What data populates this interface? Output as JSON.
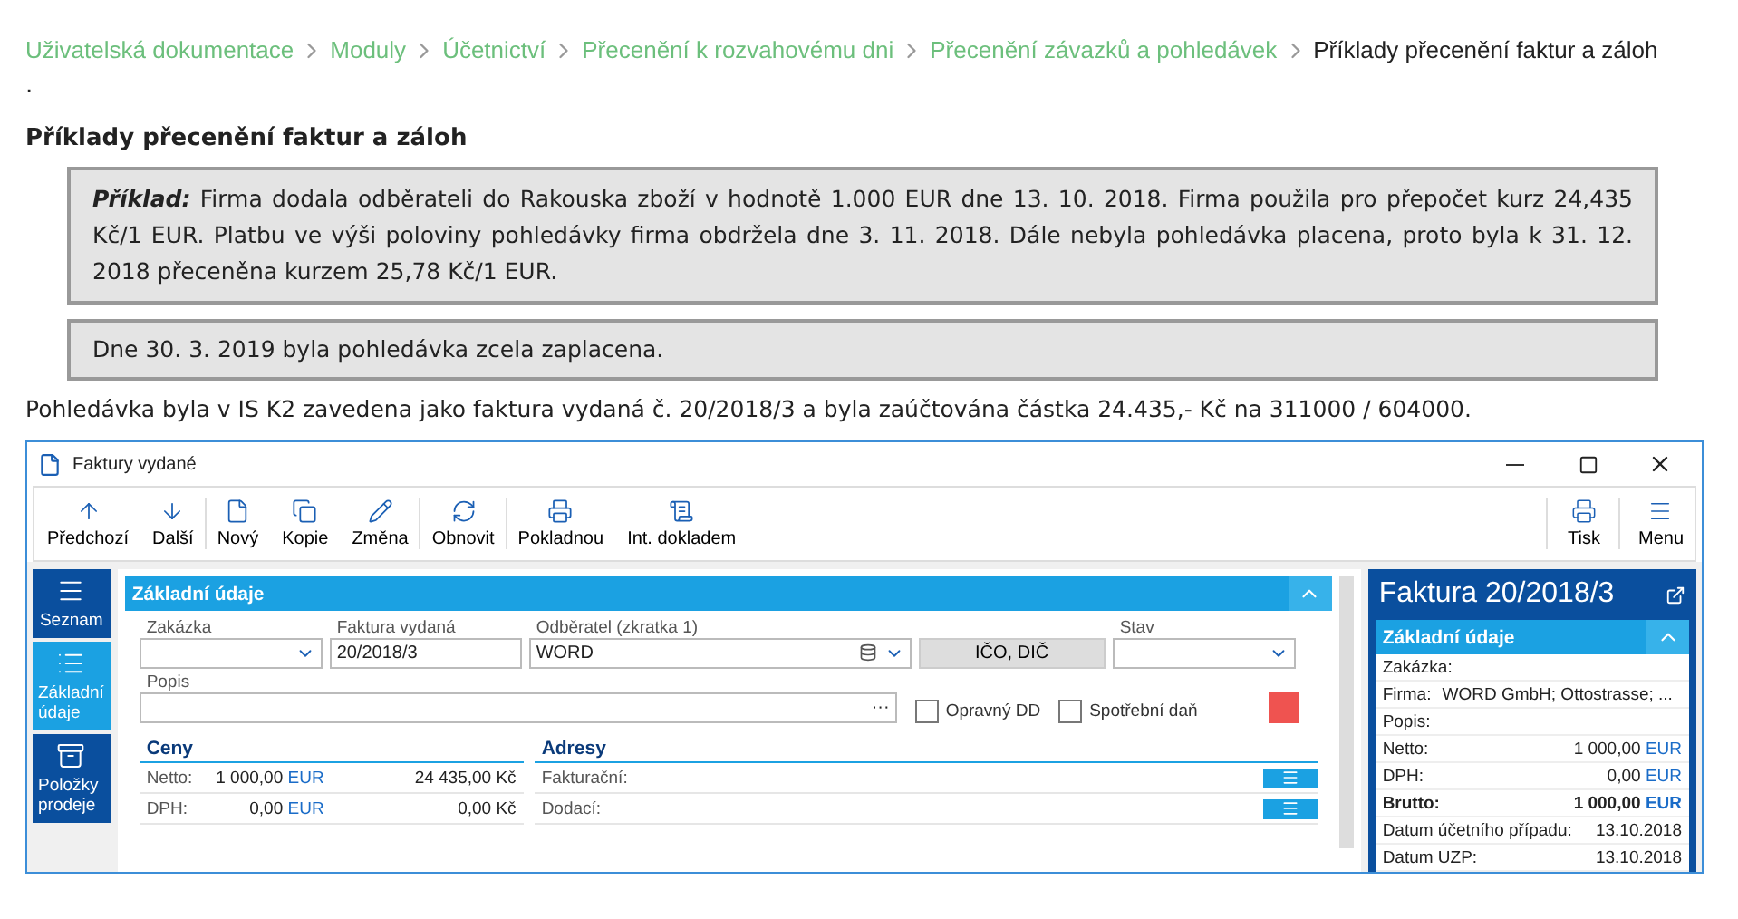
{
  "breadcrumbs": [
    {
      "label": "Uživatelská dokumentace",
      "current": false
    },
    {
      "label": "Moduly",
      "current": false
    },
    {
      "label": "Účetnictví",
      "current": false
    },
    {
      "label": "Přecenění k rozvahovému dni",
      "current": false
    },
    {
      "label": "Přecenění závazků a pohledávek",
      "current": false
    },
    {
      "label": "Příklady přecenění faktur a záloh",
      "current": true
    }
  ],
  "stray_mark": ".",
  "heading": "Příklady přecenění faktur a záloh",
  "example": {
    "label": "Příklad:",
    "text": "Firma dodala odběrateli do Rakouska zboží v hodnotě 1.000 EUR dne 13. 10. 2018. Firma použila pro přepočet kurz 24,435 Kč/1 EUR. Platbu ve výši poloviny pohledávky firma obdržela dne 3. 11. 2018. Dále nebyla pohledávka placena, proto byla k 31. 12. 2018 přeceněna kurzem 25,78 Kč/1 EUR."
  },
  "note": "Dne 30. 3. 2019 byla pohledávka zcela zaplacena.",
  "paragraph": "Pohledávka byla v IS K2 zavedena jako faktura vydaná č. 20/2018/3 a byla zaúčtována částka 24.435,- Kč na 311000 / 604000.",
  "app": {
    "title": "Faktury vydané",
    "toolbar": [
      {
        "label": "Předchozí",
        "separator_before": false
      },
      {
        "label": "Další",
        "separator_before": false
      },
      {
        "label": "Nový",
        "separator_before": true
      },
      {
        "label": "Kopie",
        "separator_before": false
      },
      {
        "label": "Změna",
        "separator_before": false
      },
      {
        "label": "Obnovit",
        "separator_before": true
      },
      {
        "label": "Pokladnou",
        "separator_before": true
      },
      {
        "label": "Int. dokladem",
        "separator_before": false
      }
    ],
    "toolbar_right": [
      {
        "label": "Tisk"
      },
      {
        "label": "Menu"
      }
    ],
    "nav": [
      {
        "label": "Seznam",
        "selected": false
      },
      {
        "label": "Základní údaje",
        "selected": true
      },
      {
        "label": "Položky prodeje",
        "selected": false
      }
    ],
    "section_title": "Základní údaje",
    "fields": [
      {
        "kind": "dropdown",
        "label": "Zakázka"
      },
      {
        "kind": "text",
        "label": "Faktura vydaná",
        "value": "20/2018/3"
      },
      {
        "kind": "lookup",
        "label": "Odběratel (zkratka 1)",
        "value": "WORD"
      },
      {
        "kind": "button",
        "value": "IČO, DIČ"
      },
      {
        "kind": "dropdown",
        "label": "Stav"
      }
    ],
    "description": {
      "label": "Popis",
      "more": "···"
    },
    "checkboxes": [
      {
        "label": "Opravný DD",
        "checked": false
      },
      {
        "label": "Spotřební daň",
        "checked": false
      }
    ],
    "color_swatch": {
      "color": "#ef5350"
    },
    "prices": {
      "title": "Ceny",
      "rows": [
        {
          "label": "Netto:",
          "amount": "1 000,00",
          "currency": "EUR",
          "local": "24 435,00 Kč"
        },
        {
          "label": "DPH:",
          "amount": "0,00",
          "currency": "EUR",
          "local": "0,00 Kč"
        }
      ]
    },
    "addresses": {
      "title": "Adresy",
      "rows": [
        {
          "label": "Fakturační:"
        },
        {
          "label": "Dodací:"
        }
      ]
    },
    "panel": {
      "title": "Faktura 20/2018/3",
      "section_title": "Základní údaje",
      "rows": [
        {
          "kind": "pair",
          "label": "Zakázka:"
        },
        {
          "kind": "pair",
          "label": "Firma:",
          "value": "WORD GmbH; Ottostrasse; ..."
        },
        {
          "kind": "pair",
          "label": "Popis:"
        },
        {
          "kind": "money",
          "label": "Netto:",
          "amount": "1 000,00",
          "currency": "EUR",
          "bold": false
        },
        {
          "kind": "money",
          "label": "DPH:",
          "amount": "0,00",
          "currency": "EUR",
          "bold": false
        },
        {
          "kind": "money",
          "label": "Brutto:",
          "amount": "1 000,00",
          "currency": "EUR",
          "bold": true
        },
        {
          "kind": "date",
          "label": "Datum účetního případu:",
          "value": "13.10.2018"
        },
        {
          "kind": "date",
          "label": "Datum UZP:",
          "value": "13.10.2018"
        }
      ]
    }
  }
}
